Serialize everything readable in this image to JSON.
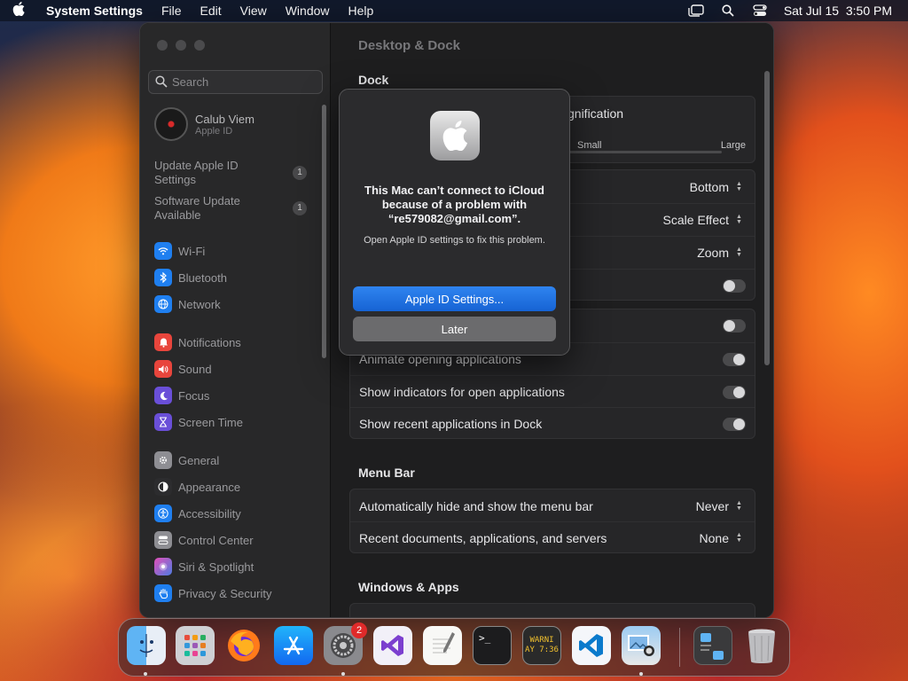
{
  "menubar": {
    "app_name": "System Settings",
    "menus": [
      "File",
      "Edit",
      "View",
      "Window",
      "Help"
    ],
    "datetime": "Sat Jul 15  3:50 PM"
  },
  "sidebar": {
    "search_placeholder": "Search",
    "profile": {
      "name": "Calub Viem",
      "subtitle": "Apple ID"
    },
    "alerts": [
      {
        "label": "Update Apple ID Settings",
        "count": "1"
      },
      {
        "label": "Software Update Available",
        "count": "1"
      }
    ],
    "items": [
      {
        "label": "Wi-Fi",
        "icon": "wifi-icon",
        "color": "#1f7ff0"
      },
      {
        "label": "Bluetooth",
        "icon": "bluetooth-icon",
        "color": "#1f7ff0"
      },
      {
        "label": "Network",
        "icon": "network-icon",
        "color": "#1f7ff0"
      },
      {
        "label": "Notifications",
        "icon": "bell-icon",
        "color": "#e8453c"
      },
      {
        "label": "Sound",
        "icon": "speaker-icon",
        "color": "#e8453c"
      },
      {
        "label": "Focus",
        "icon": "moon-icon",
        "color": "#6a4fd8"
      },
      {
        "label": "Screen Time",
        "icon": "hourglass-icon",
        "color": "#6a4fd8"
      },
      {
        "label": "General",
        "icon": "gear-icon",
        "color": "#8e8e93"
      },
      {
        "label": "Appearance",
        "icon": "appearance-icon",
        "color": "#2c2c2e"
      },
      {
        "label": "Accessibility",
        "icon": "accessibility-icon",
        "color": "#1f7ff0"
      },
      {
        "label": "Control Center",
        "icon": "control-center-icon",
        "color": "#8e8e93"
      },
      {
        "label": "Siri & Spotlight",
        "icon": "siri-icon",
        "color": "#c040c0"
      },
      {
        "label": "Privacy & Security",
        "icon": "hand-icon",
        "color": "#1f7ff0"
      }
    ]
  },
  "content": {
    "title": "Desktop & Dock",
    "dock_section": "Dock",
    "magnification_label": "gnification",
    "slider_min": "Small",
    "slider_max": "Large",
    "position_value": "Bottom",
    "minimize_value": "Scale Effect",
    "double_click_value": "Zoom",
    "animate_label": "Animate opening applications",
    "indicators_label": "Show indicators for open applications",
    "recent_label": "Show recent applications in Dock",
    "menubar_section": "Menu Bar",
    "autohide_label": "Automatically hide and show the menu bar",
    "autohide_value": "Never",
    "recent_docs_label": "Recent documents, applications, and servers",
    "recent_docs_value": "None",
    "windows_section": "Windows & Apps"
  },
  "alert": {
    "title": "This Mac can’t connect to iCloud because of a problem with “re579082@gmail.com”.",
    "message": "Open Apple ID settings to fix this problem.",
    "primary_button": "Apple ID Settings...",
    "secondary_button": "Later"
  },
  "dock": {
    "apps": [
      "finder-icon",
      "launchpad-icon",
      "firefox-icon",
      "app-store-icon",
      "system-settings-icon",
      "visual-studio-icon",
      "textedit-icon",
      "terminal-icon",
      "console-icon",
      "vscode-icon",
      "preview-icon",
      "downloads-stack-icon",
      "trash-icon"
    ],
    "settings_badge": "2",
    "terminal_glyph": ">_",
    "console_text": "WARNI\nAY 7:36"
  }
}
